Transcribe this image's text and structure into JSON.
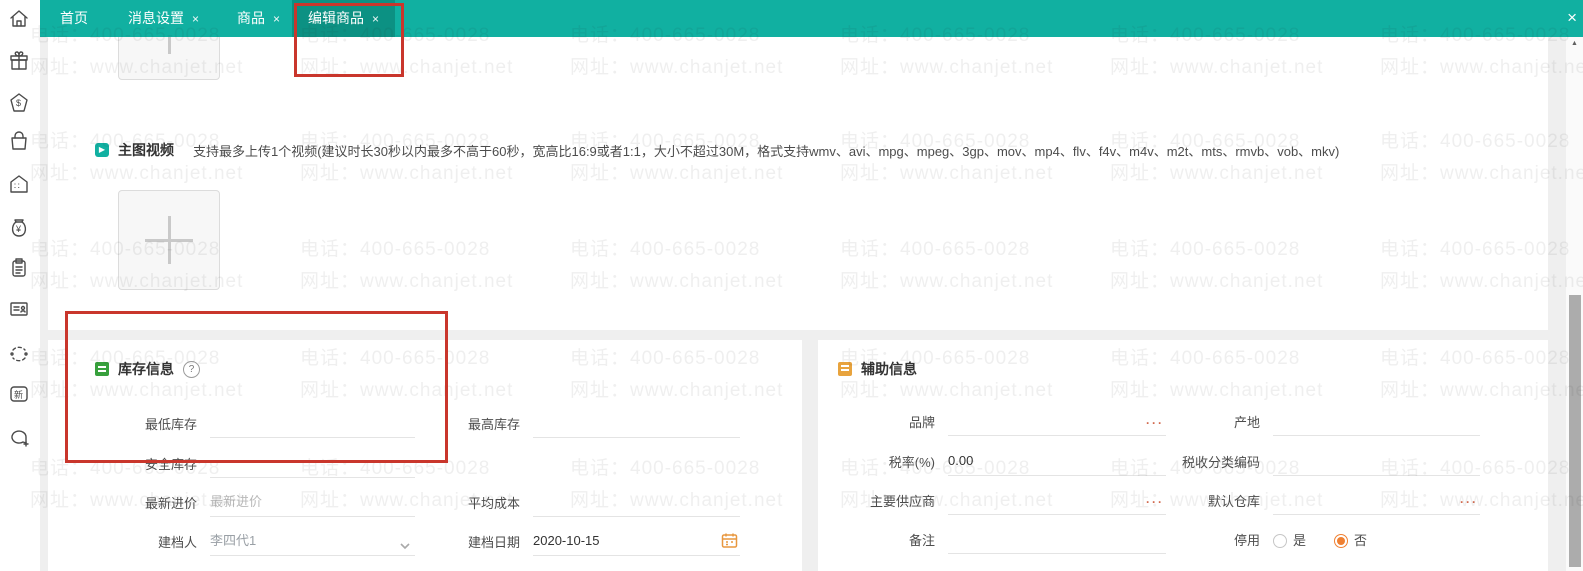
{
  "colors": {
    "accent_teal": "#11b0a1",
    "active_tab": "#0c9183",
    "highlight_red": "#c9362c",
    "radio_orange": "#ef8032",
    "inventory_green": "#37a03c",
    "auxiliary_amber": "#e8a33d"
  },
  "watermark": {
    "line1": "电话：400-665-0028",
    "line2": "网址：www.chanjet.net"
  },
  "tabbar": {
    "tabs": [
      {
        "label": "首页"
      },
      {
        "label": "消息设置"
      },
      {
        "label": "商品"
      },
      {
        "label": "编辑商品"
      }
    ],
    "tab_close_glyph": "×",
    "window_close_glyph": "×"
  },
  "sidebar": {
    "icons": [
      "home-icon",
      "gift-icon",
      "store-dollar-icon",
      "bag-icon",
      "warehouse-icon",
      "money-bag-icon",
      "clipboard-icon",
      "contact-card-icon",
      "sync-icon",
      "new-badge-icon",
      "chat-icon"
    ]
  },
  "video_section": {
    "title": "主图视频",
    "description": "支持最多上传1个视频(建议时长30秒以内最多不高于60秒，宽高比16:9或者1:1，大小不超过30M，格式支持wmv、avi、mpg、mpeg、3gp、mov、mp4、flv、f4v、m4v、m2t、mts、rmvb、vob、mkv)",
    "play_glyph": "▶"
  },
  "inventory_section": {
    "title": "库存信息",
    "help_glyph": "?",
    "min_stock_label": "最低库存",
    "max_stock_label": "最高库存",
    "safe_stock_label": "安全库存",
    "latest_price_label": "最新进价",
    "latest_price_placeholder": "最新进价",
    "avg_cost_label": "平均成本",
    "creator_label": "建档人",
    "creator_value": "李四代1",
    "create_date_label": "建档日期",
    "create_date_value": "2020-10-15"
  },
  "auxiliary_section": {
    "title": "辅助信息",
    "brand_label": "品牌",
    "origin_label": "产地",
    "tax_rate_label": "税率(%)",
    "tax_rate_value": "0.00",
    "tax_code_label": "税收分类编码",
    "supplier_label": "主要供应商",
    "warehouse_label": "默认仓库",
    "remark_label": "备注",
    "disabled_label": "停用",
    "disabled_yes": "是",
    "disabled_no": "否",
    "ellipsis_glyph": "···"
  },
  "scrollbar": {
    "up_glyph": "▲"
  }
}
